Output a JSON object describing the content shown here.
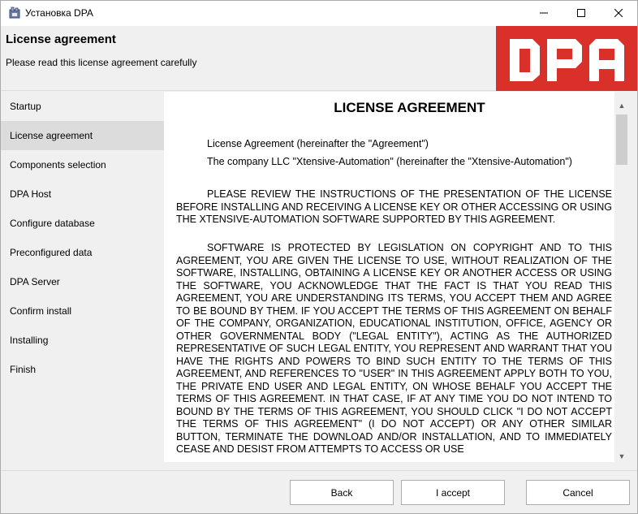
{
  "window": {
    "title": "Установка DPA",
    "icons": {
      "app": "installer-icon",
      "minimize": "minimize-icon",
      "maximize": "maximize-icon",
      "close": "close-icon"
    }
  },
  "header": {
    "title": "License agreement",
    "subtitle": "Please read this license agreement carefully",
    "logo_text": "DPA",
    "logo_color": "#d9302a"
  },
  "sidebar": {
    "items": [
      {
        "label": "Startup"
      },
      {
        "label": "License agreement"
      },
      {
        "label": "Components selection"
      },
      {
        "label": "DPA Host"
      },
      {
        "label": "Configure database"
      },
      {
        "label": "Preconfigured data"
      },
      {
        "label": "DPA Server"
      },
      {
        "label": "Confirm install"
      },
      {
        "label": "Installing"
      },
      {
        "label": "Finish"
      }
    ],
    "active_index": 1
  },
  "license": {
    "title": "LICENSE AGREEMENT",
    "line1": "License Agreement (hereinafter the \"Agreement\")",
    "line2": "The company LLC \"Xtensive-Automation\" (hereinafter the \"Xtensive-Automation\")",
    "para1": "PLEASE REVIEW THE INSTRUCTIONS OF THE PRESENTATION OF THE LICENSE BEFORE INSTALLING AND RECEIVING A LICENSE KEY OR OTHER ACCESSING OR USING THE XTENSIVE-AUTOMATION SOFTWARE SUPPORTED BY THIS AGREEMENT.",
    "para2": "SOFTWARE IS PROTECTED BY LEGISLATION ON COPYRIGHT AND TO THIS AGREEMENT, YOU ARE GIVEN THE LICENSE TO USE, WITHOUT REALIZATION OF THE SOFTWARE, INSTALLING, OBTAINING A LICENSE KEY OR ANOTHER ACCESS OR USING THE SOFTWARE, YOU ACKNOWLEDGE THAT THE FACT IS THAT YOU READ THIS AGREEMENT, YOU ARE UNDERSTANDING ITS TERMS, YOU ACCEPT THEM AND AGREE TO BE BOUND BY THEM. IF YOU ACCEPT THE TERMS OF THIS AGREEMENT ON BEHALF OF THE COMPANY, ORGANIZATION, EDUCATIONAL INSTITUTION, OFFICE, AGENCY OR OTHER GOVERNMENTAL BODY (\"LEGAL ENTITY\"), ACTING AS THE AUTHORIZED REPRESENTATIVE OF SUCH LEGAL ENTITY, YOU REPRESENT AND WARRANT THAT YOU HAVE THE RIGHTS AND POWERS TO BIND SUCH ENTITY TO THE TERMS OF THIS AGREEMENT, AND REFERENCES TO \"USER\" IN THIS AGREEMENT APPLY BOTH TO YOU, THE PRIVATE END USER AND LEGAL ENTITY, ON WHOSE BEHALF YOU ACCEPT THE TERMS OF THIS AGREEMENT. IN THAT CASE, IF AT ANY TIME YOU DO NOT INTEND TO BOUND BY THE TERMS OF THIS AGREEMENT, YOU SHOULD CLICK \"I DO NOT ACCEPT THE TERMS OF THIS AGREEMENT\" (I DO NOT ACCEPT) OR ANY OTHER SIMILAR BUTTON, TERMINATE THE DOWNLOAD AND/OR INSTALLATION, AND TO IMMEDIATELY CEASE AND DESIST FROM ATTEMPTS TO ACCESS OR USE"
  },
  "buttons": {
    "back": "Back",
    "accept": "I accept",
    "cancel": "Cancel"
  }
}
